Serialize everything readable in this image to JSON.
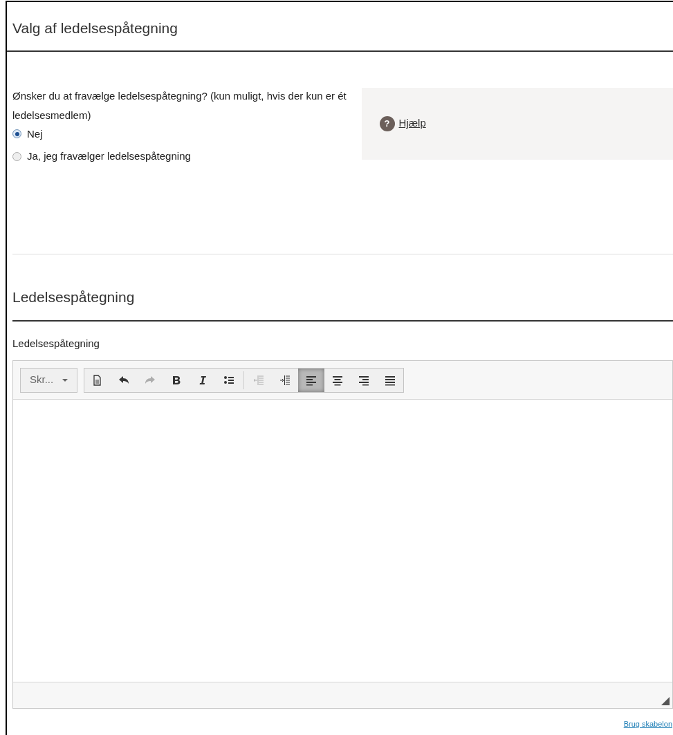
{
  "section_1": {
    "title": "Valg af ledelsespåtegning"
  },
  "question": {
    "label": "Ønsker du at fravælge ledelsespåtegning? (kun muligt, hvis der kun er ét ledelsesmedlem)",
    "options": [
      {
        "label": "Nej",
        "selected": true
      },
      {
        "label": "Ja, jeg fravælger ledelsespåtegning",
        "selected": false
      }
    ]
  },
  "help": {
    "icon_text": "?",
    "link": "Hjælp"
  },
  "section_2": {
    "title": "Ledelsespåtegning"
  },
  "editor": {
    "label": "Ledelsespåtegning",
    "format_dropdown": "Skr...",
    "toolbar": [
      {
        "kind": "document",
        "disabled": false,
        "selected": false
      },
      {
        "kind": "undo",
        "disabled": false,
        "selected": false
      },
      {
        "kind": "redo",
        "disabled": true,
        "selected": false
      },
      {
        "kind": "bold",
        "disabled": false,
        "selected": false
      },
      {
        "kind": "italic",
        "disabled": false,
        "selected": false
      },
      {
        "kind": "bullets",
        "disabled": false,
        "selected": false
      },
      {
        "kind": "outdent",
        "disabled": true,
        "selected": false
      },
      {
        "kind": "indent",
        "disabled": false,
        "selected": false
      },
      {
        "kind": "align-left",
        "disabled": false,
        "selected": true
      },
      {
        "kind": "align-center",
        "disabled": false,
        "selected": false
      },
      {
        "kind": "align-right",
        "disabled": false,
        "selected": false
      },
      {
        "kind": "justify",
        "disabled": false,
        "selected": false
      }
    ]
  },
  "template_link": "Brug skabelon"
}
